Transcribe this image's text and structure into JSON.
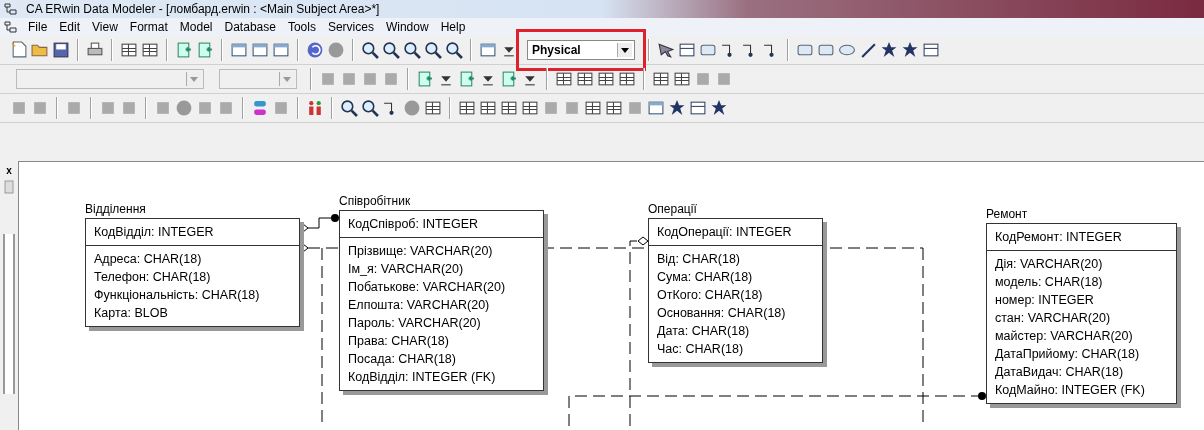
{
  "window": {
    "title": "CA ERwin Data Modeler - [ломбард.erwin : <Main Subject Area>*]"
  },
  "menu": [
    "File",
    "Edit",
    "View",
    "Format",
    "Model",
    "Database",
    "Tools",
    "Services",
    "Window",
    "Help"
  ],
  "display_level": {
    "value": "Physical",
    "highlighted": true
  },
  "side_panel": {
    "close": "x"
  },
  "entities": [
    {
      "name": "Відділення",
      "keys": [
        "КодВідділ: INTEGER"
      ],
      "attributes": [
        "Адреса: CHAR(18)",
        "Телефон: CHAR(18)",
        "Функціональність: CHAR(18)",
        "Карта: BLOB"
      ]
    },
    {
      "name": "Співробітник",
      "keys": [
        "КодСпівроб: INTEGER"
      ],
      "attributes": [
        "Прізвище: VARCHAR(20)",
        "Ім_я: VARCHAR(20)",
        "Побатькове: VARCHAR(20)",
        "Елпошта: VARCHAR(20)",
        "Пароль: VARCHAR(20)",
        "Права: CHAR(18)",
        "Посада: CHAR(18)",
        "КодВідділ: INTEGER (FK)"
      ]
    },
    {
      "name": "Операції",
      "keys": [
        "КодОперації: INTEGER"
      ],
      "attributes": [
        "Від: CHAR(18)",
        "Сума: CHAR(18)",
        "ОтКого: CHAR(18)",
        "Основання: CHAR(18)",
        "Дата: CHAR(18)",
        "Час: CHAR(18)"
      ]
    },
    {
      "name": "Ремонт",
      "keys": [
        "КодРемонт: INTEGER"
      ],
      "attributes": [
        "Дія: VARCHAR(20)",
        "модель: CHAR(18)",
        "номер: INTEGER",
        "стан: VARCHAR(20)",
        "майстер: VARCHAR(20)",
        "ДатаПрийому: CHAR(18)",
        "ДатаВидач: CHAR(18)",
        "КодМайно: INTEGER (FK)"
      ]
    }
  ]
}
